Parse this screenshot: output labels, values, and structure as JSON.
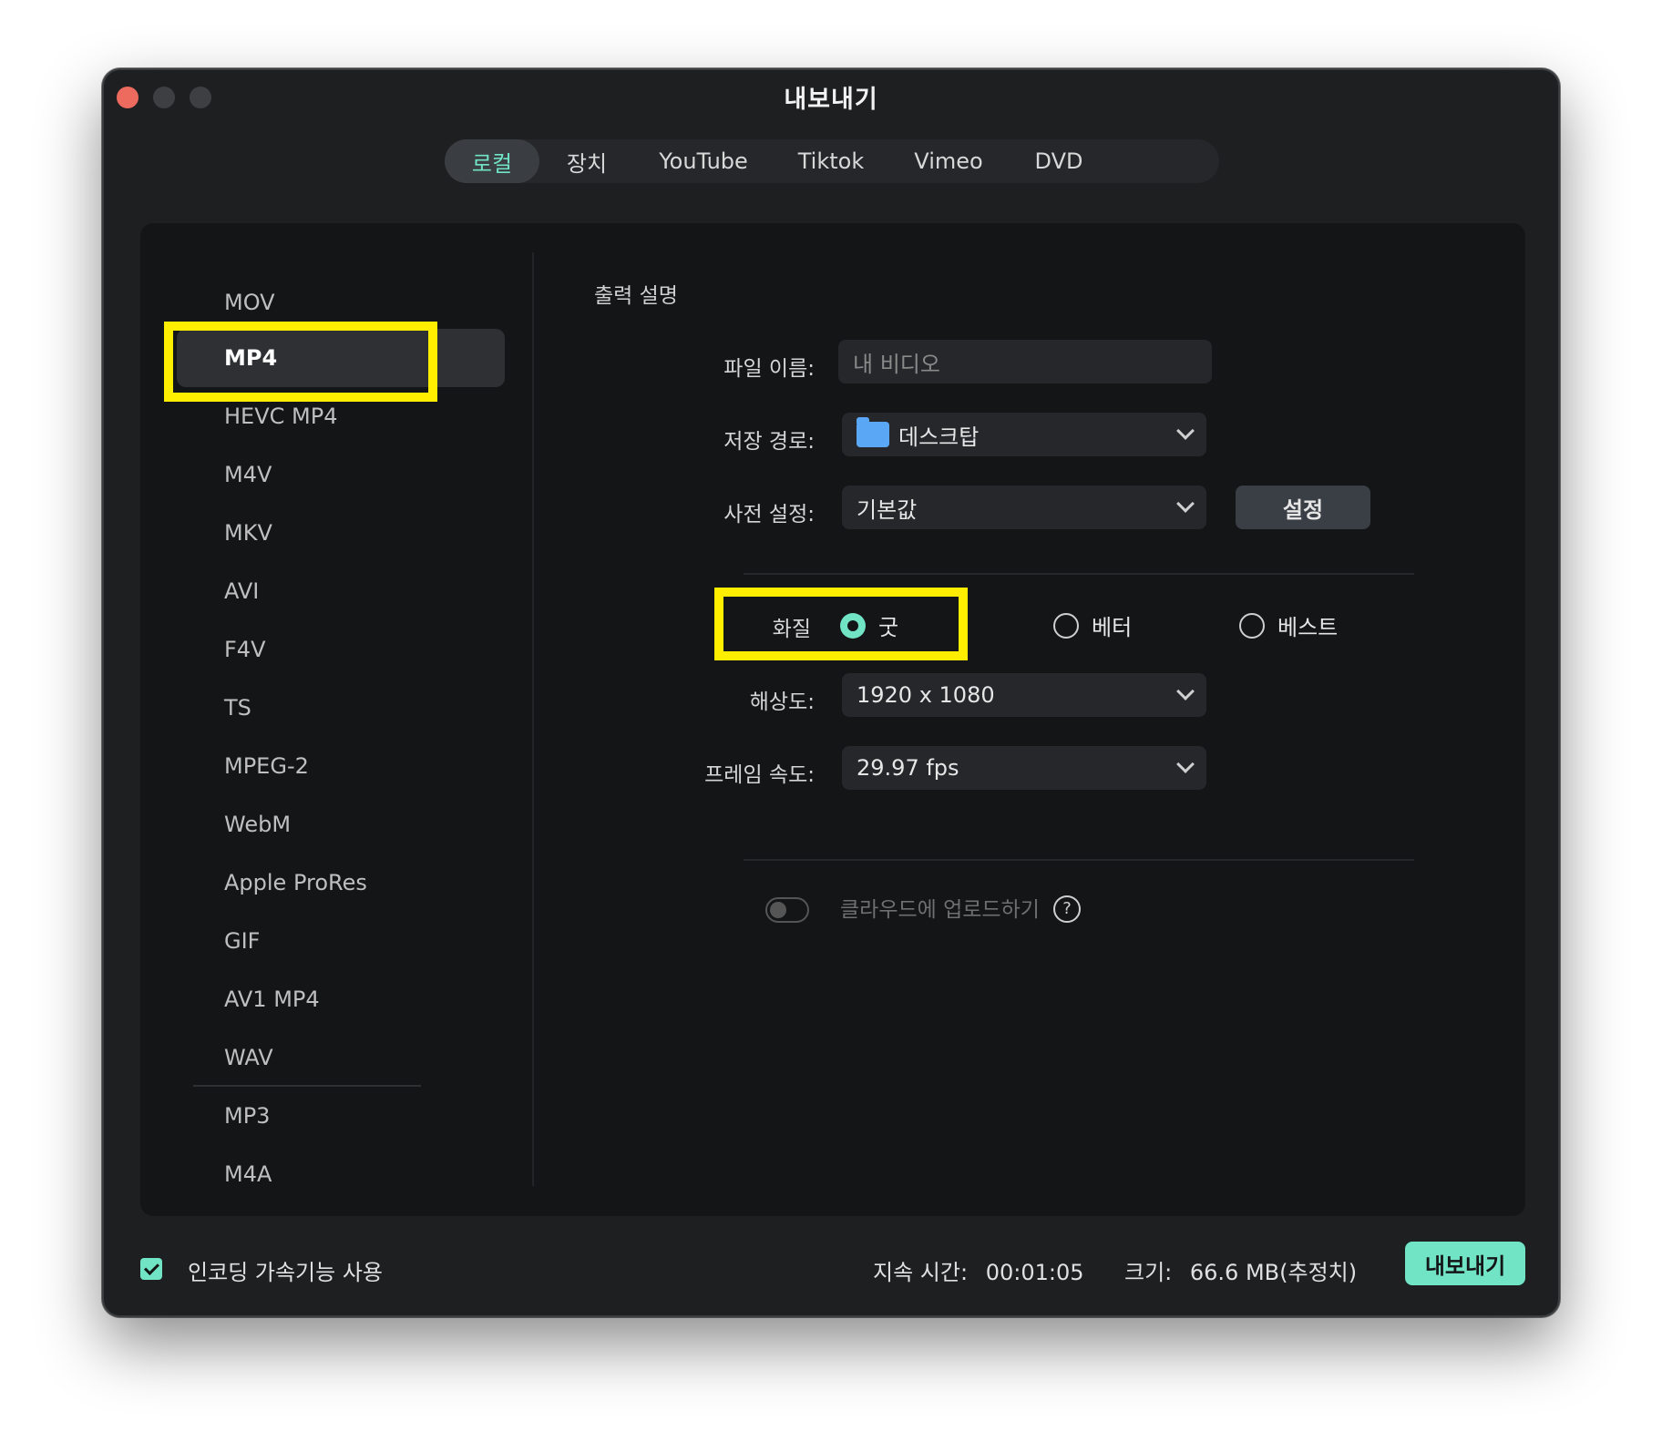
{
  "window": {
    "title": "내보내기"
  },
  "tabs": [
    {
      "label": "로컬",
      "active": true
    },
    {
      "label": "장치",
      "active": false
    },
    {
      "label": "YouTube",
      "active": false
    },
    {
      "label": "Tiktok",
      "active": false
    },
    {
      "label": "Vimeo",
      "active": false
    },
    {
      "label": "DVD",
      "active": false
    }
  ],
  "formats": [
    "MOV",
    "MP4",
    "HEVC MP4",
    "M4V",
    "MKV",
    "AVI",
    "F4V",
    "TS",
    "MPEG-2",
    "WebM",
    "Apple ProRes",
    "GIF",
    "AV1 MP4",
    "WAV",
    "MP3",
    "M4A"
  ],
  "selected_format": "MP4",
  "output": {
    "section_title": "출력 설명",
    "filename_label": "파일 이름:",
    "filename_placeholder": "내 비디오",
    "path_label": "저장 경로:",
    "path_value": "데스크탑",
    "preset_label": "사전 설정:",
    "preset_value": "기본값",
    "settings_button": "설정",
    "quality_label": "화질",
    "quality_options": [
      "굿",
      "베터",
      "베스트"
    ],
    "quality_selected": "굿",
    "resolution_label": "해상도:",
    "resolution_value": "1920 x 1080",
    "framerate_label": "프레임 속도:",
    "framerate_value": "29.97 fps",
    "cloud_label": "클라우드에 업로드하기",
    "help_glyph": "?"
  },
  "footer": {
    "encoding_label": "인코딩 가속기능 사용",
    "encoding_checked": true,
    "duration_label": "지속 시간:",
    "duration_value": "00:01:05",
    "size_label": "크기:",
    "size_value": "66.6 MB(추정치)",
    "export_button": "내보내기"
  },
  "colors": {
    "accent": "#71e4c6",
    "highlight": "#ffee00",
    "background": "#1d1f21",
    "panel": "#141517"
  }
}
